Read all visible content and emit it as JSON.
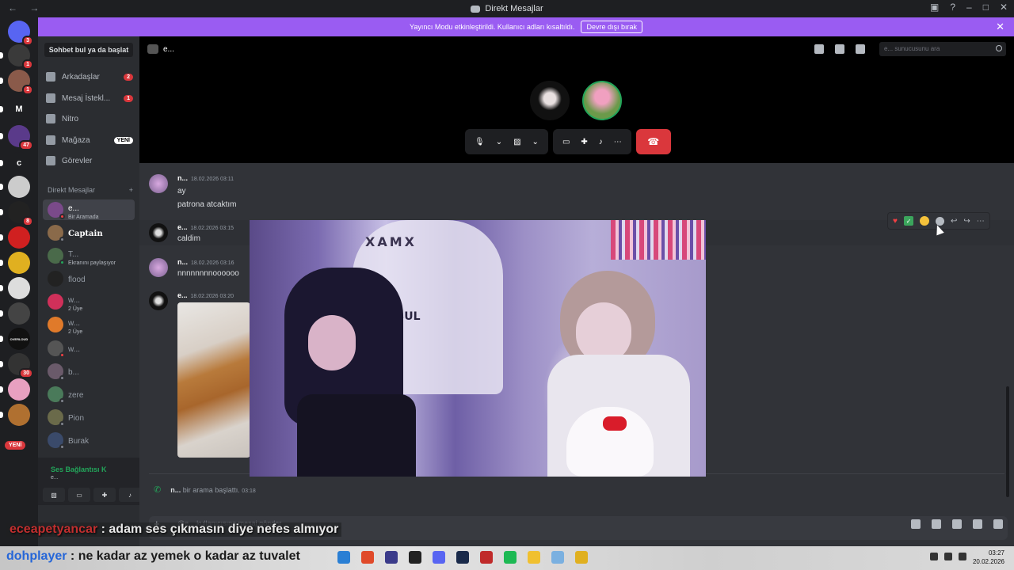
{
  "window": {
    "title": "Direkt Mesajlar",
    "nav": "← →"
  },
  "banner": {
    "text": "Yayıncı Modu etkinleştirildi. Kullanıcı adları kısaltıldı.",
    "button": "Devre dışı bırak"
  },
  "guilds": [
    {
      "badge": "3"
    },
    {
      "badge": "1"
    },
    {
      "badge": "1"
    },
    {
      "letter": "M"
    },
    {
      "badge": "47"
    },
    {
      "letter": "c"
    },
    {
      "badge": ""
    },
    {
      "badge": "8"
    },
    {
      "badge": ""
    },
    {
      "badge": ""
    },
    {
      "badge": ""
    },
    {
      "badge": ""
    },
    {
      "letter": "OVERLOUD"
    },
    {
      "badge": "30"
    },
    {
      "badge": ""
    },
    {
      "badge": ""
    }
  ],
  "guild_new_label": "YENİ",
  "sidebar": {
    "find_label": "Sohbet bul ya da başlat",
    "nav": [
      {
        "label": "Arkadaşlar",
        "count": "2"
      },
      {
        "label": "Mesaj İstekl...",
        "count": "1"
      },
      {
        "label": "Nitro",
        "count": ""
      },
      {
        "label": "Mağaza",
        "new": "YENİ"
      },
      {
        "label": "Görevler",
        "count": ""
      }
    ],
    "dm_header": "Direkt Mesajlar",
    "dms": [
      {
        "name": "e...",
        "sub": "Bir Aramada"
      },
      {
        "name": "Captain",
        "sub": ""
      },
      {
        "name": "T...",
        "sub": "Ekranını paylaşıyor"
      },
      {
        "name": "flood",
        "sub": ""
      },
      {
        "name": "w...",
        "sub": "2 Üye"
      },
      {
        "name": "w...",
        "sub": "2 Üye"
      },
      {
        "name": "w...",
        "sub": ""
      },
      {
        "name": "b...",
        "sub": ""
      },
      {
        "name": "zere",
        "sub": ""
      },
      {
        "name": "Pion",
        "sub": ""
      },
      {
        "name": "Burak",
        "sub": ""
      }
    ],
    "voice": {
      "title": "Ses Bağlantısı K",
      "sub": "e..."
    }
  },
  "call": {
    "header_name": "e...",
    "search_placeholder": "e... sunucusunu ara"
  },
  "messages": [
    {
      "author": "n...",
      "time": "18.02.2026 03:11",
      "lines": [
        "ay",
        "patrona atcaktım"
      ]
    },
    {
      "author": "e...",
      "time": "18.02.2026 03:15",
      "lines": [
        "caldim"
      ]
    },
    {
      "author": "n...",
      "time": "18.02.2026 03:16",
      "lines": [
        "nnnnnnnnoooooo"
      ]
    },
    {
      "author": "e...",
      "time": "18.02.2026 03:20",
      "lines": []
    }
  ],
  "call_log": {
    "author": "n...",
    "text": "bir arama başlattı.",
    "time": "03:18"
  },
  "input_placeholder": "@e... kullanıcısına mesaj gönder",
  "video_text": {
    "logo": "XAMX",
    "chair": "NABUL"
  },
  "overlay": [
    {
      "user": "eceapetyancar",
      "text": " : adam ses çıkmasın diye nefes almıyor"
    },
    {
      "user": "dohplayer",
      "text": " : ne kadar az yemek o kadar az tuvalet"
    }
  ],
  "taskbar": {
    "time": "03:27",
    "date": "20.02.2026"
  },
  "colors": {
    "accent": "#5865f2",
    "banner": "#9a5cf2",
    "danger": "#da373c",
    "online": "#23a55a"
  }
}
